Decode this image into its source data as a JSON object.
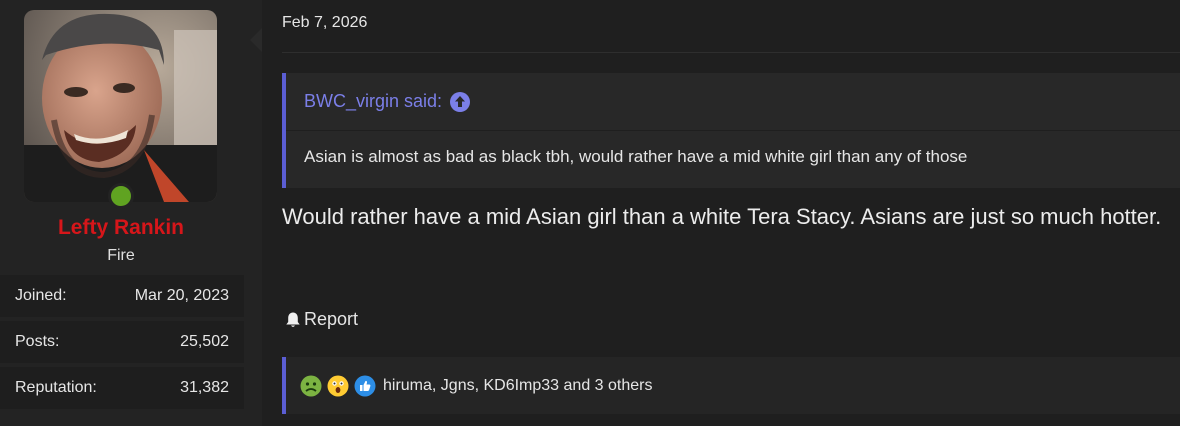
{
  "user": {
    "name": "Lefty Rankin",
    "title": "Fire",
    "stats": [
      {
        "label": "Joined:",
        "value": "Mar 20, 2023"
      },
      {
        "label": "Posts:",
        "value": "25,502"
      },
      {
        "label": "Reputation:",
        "value": "31,382"
      }
    ],
    "online_color": "#60a321",
    "name_color": "#d6161a"
  },
  "post": {
    "date": "Feb 7, 2026",
    "quote": {
      "author_line": "BWC_virgin said:",
      "text": "Asian is almost as bad as black tbh, would rather have a mid white girl than any of those"
    },
    "text": "Would rather have a mid Asian girl than a white Tera Stacy. Asians are just so much hotter.",
    "report_label": "Report",
    "reactions": {
      "icons": [
        "sick-emoji-icon",
        "shocked-emoji-icon",
        "thumbs-up-icon"
      ],
      "names": "hiruma, Jgns, KD6Imp33 and 3 others"
    }
  }
}
